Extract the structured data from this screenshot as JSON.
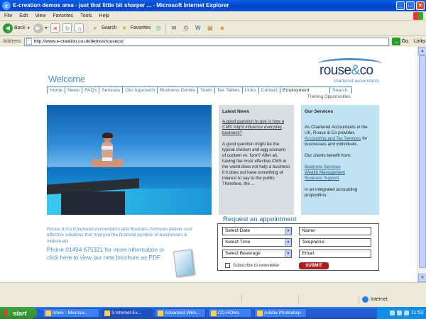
{
  "window": {
    "title": "E-creation demos area - just that little bit sharper ... - Microsoft Internet Explorer"
  },
  "menu": [
    "File",
    "Edit",
    "View",
    "Favorites",
    "Tools",
    "Help"
  ],
  "toolbar": {
    "back_label": "Back",
    "search_label": "Search",
    "favorites_label": "Favorites"
  },
  "address": {
    "label": "Address",
    "url": "http://www.e-creation.co.uk/demos/rouseco/",
    "go_label": "Go",
    "links_label": "Links"
  },
  "site": {
    "welcome": "Welcome",
    "logo_name": "rouse",
    "logo_amp": "&",
    "logo_co": "co",
    "logo_sub": "chartered accountants",
    "nav": [
      "Home",
      "News",
      "FAQs",
      "Services",
      "Our Approach",
      "Business Centre",
      "Team",
      "Tax Tables",
      "Links",
      "Contact",
      "Employment",
      "Search"
    ],
    "training": "Training Opportunities",
    "news": {
      "heading": "Latest News",
      "link": "A good question to ask is how a CMS might influence everyday business?",
      "body": "A good question might be the typical chicken and egg scenario of content vs. form? After all, having the most effective CMS in the world does not help a business if it does not have something of interest to say to the public. Therefore, the ..."
    },
    "services": {
      "heading": "Our Services",
      "intro_pre": "As Chartered Accountants in the UK, Rouse & Co provides ",
      "intro_link": "Accounting and Tax Services",
      "intro_post": " for businesses and individuals.",
      "benefit": "Our clients benefit from:",
      "links": [
        "Business Services",
        "Wealth Management",
        "Business Support"
      ],
      "outro": "in an integrated accounting proposition."
    },
    "about": {
      "text": "Rouse & Co Chartered Accountants and Business Advisors deliver cost effective solutions that improve the financial position of businesses & individuals.",
      "phone": "Phone 01494 675321 for more information or click here to view our new brochure as PDF."
    },
    "appointment": {
      "title": "Request an appointment",
      "selects": [
        "Select Date",
        "Select Time",
        "Select Beverage"
      ],
      "fields": [
        "Name:",
        "Telephone:",
        "Email:"
      ],
      "subscribe": "Subscribe to newsletter",
      "submit": "SUBMIT"
    }
  },
  "status": {
    "zone": "Internet"
  },
  "taskbar": {
    "start": "start",
    "tasks": [
      "Inbox - Microso...",
      "3 Internet Ex...",
      "Advanced Web...",
      "CD-ROMs",
      "Adobe Photoshop"
    ],
    "clock": "11:53"
  }
}
